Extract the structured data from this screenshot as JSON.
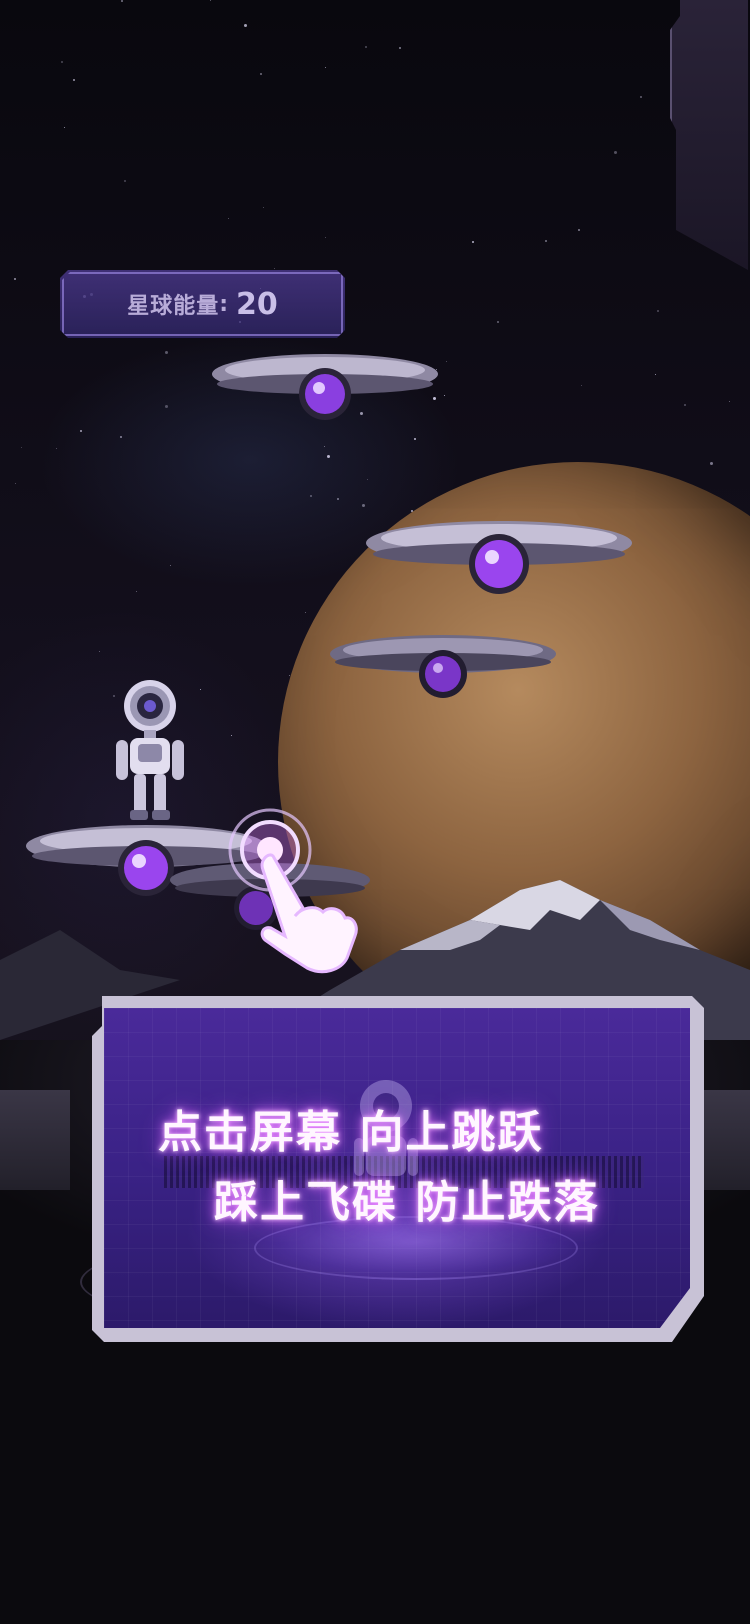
{
  "energy": {
    "label": "星球能量",
    "colon": ":",
    "value": "20"
  },
  "instructions": {
    "line1": "点击屏幕 向上跳跃",
    "line2": "踩上飞碟 防止跌落"
  },
  "colors": {
    "accent_purple": "#8a3fe0",
    "panel_purple": "#4a2a9a",
    "glow_pink": "#e87aff",
    "saucer_metal": "#a59fb8"
  },
  "icons": {
    "tap_hint": "pointing-hand-icon",
    "player": "robot-icon"
  }
}
